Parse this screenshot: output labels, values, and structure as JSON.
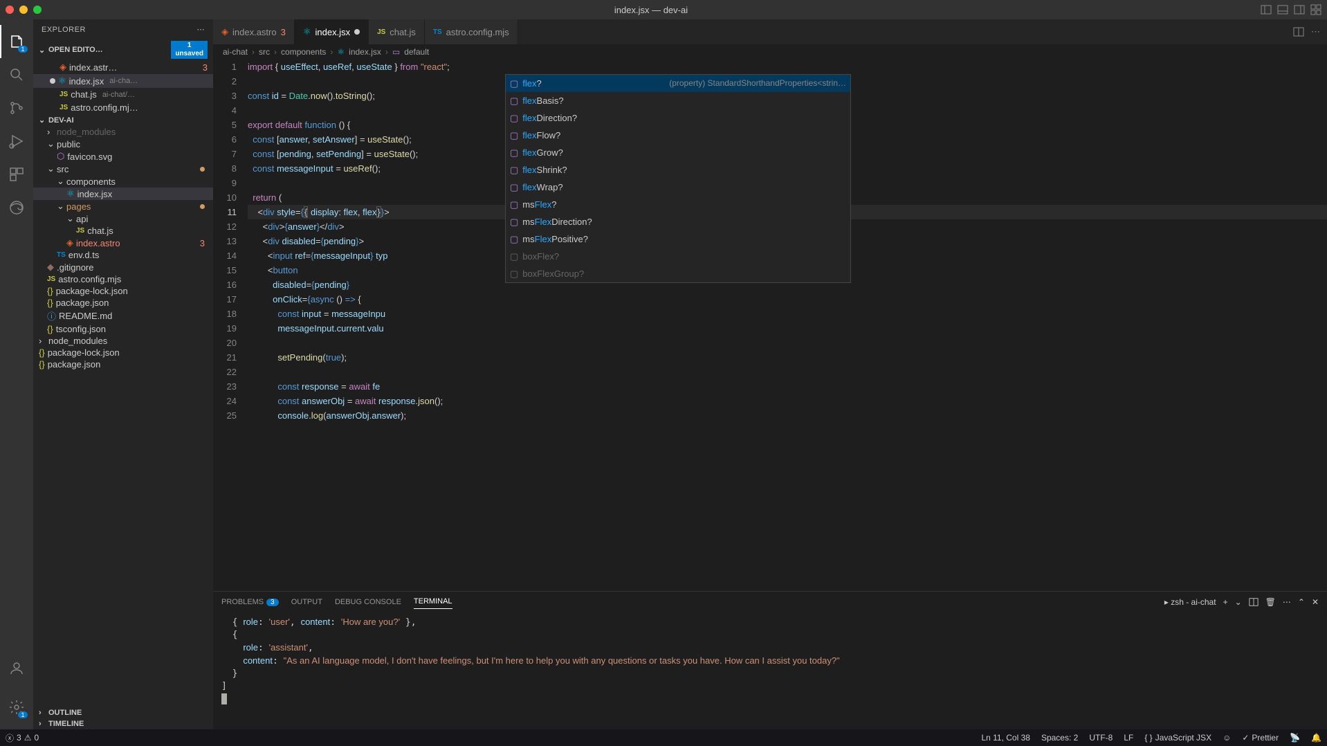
{
  "window": {
    "title": "index.jsx — dev-ai"
  },
  "tabs": [
    {
      "label": "index.astro",
      "err": "3",
      "icon": "astro"
    },
    {
      "label": "index.jsx",
      "dirty": true,
      "icon": "react",
      "active": true
    },
    {
      "label": "chat.js",
      "icon": "js"
    },
    {
      "label": "astro.config.mjs",
      "icon": "ts"
    }
  ],
  "breadcrumb": [
    "ai-chat",
    "src",
    "components",
    "index.jsx",
    "default"
  ],
  "sidebar": {
    "title": "EXPLORER",
    "open_editors_label": "OPEN EDITO…",
    "unsaved": {
      "count": "1",
      "label": "unsaved"
    },
    "open_editors": [
      {
        "name": "index.astr…",
        "err": "3"
      },
      {
        "name": "index.jsx",
        "path": "ai-cha…",
        "dirty": true
      },
      {
        "name": "chat.js",
        "path": "ai-chat/…"
      },
      {
        "name": "astro.config.mj…"
      }
    ],
    "project": "DEV-AI",
    "tree": {
      "node_modules_top": "node_modules",
      "public": "public",
      "favicon": "favicon.svg",
      "src": "src",
      "components": "components",
      "index_jsx": "index.jsx",
      "pages": "pages",
      "api": "api",
      "chat_js": "chat.js",
      "index_astro": "index.astro",
      "index_astro_err": "3",
      "env": "env.d.ts",
      "gitignore": ".gitignore",
      "astro_config": "astro.config.mjs",
      "pkg_lock": "package-lock.json",
      "pkg": "package.json",
      "readme": "README.md",
      "tsconfig": "tsconfig.json",
      "node_modules": "node_modules",
      "pkg_lock2": "package-lock.json",
      "pkg2": "package.json"
    },
    "outline": "OUTLINE",
    "timeline": "TIMELINE"
  },
  "code": {
    "lines": [
      "import { useEffect, useRef, useState } from \"react\";",
      "",
      "const id = Date.now().toString();",
      "",
      "export default function () {",
      "  const [answer, setAnswer] = useState();",
      "  const [pending, setPending] = useState();",
      "  const messageInput = useRef();",
      "",
      "  return (",
      "    <div style={{ display: flex, flex}}>",
      "      <div>{answer}</div>",
      "      <div disabled={pending}>",
      "        <input ref={messageInput} typ",
      "        <button",
      "          disabled={pending}",
      "          onClick={async () => {",
      "            const input = messageInpu",
      "            messageInput.current.valu",
      "",
      "            setPending(true);",
      "",
      "            const response = await fe",
      "            const answerObj = await response.json();",
      "            console.log(answerObj.answer);"
    ]
  },
  "suggest": {
    "doc": "(property) StandardShorthandProperties<strin…",
    "items": [
      {
        "match": "flex",
        "rest": "?",
        "sel": true
      },
      {
        "match": "flex",
        "rest": "Basis?"
      },
      {
        "match": "flex",
        "rest": "Direction?"
      },
      {
        "match": "flex",
        "rest": "Flow?"
      },
      {
        "match": "flex",
        "rest": "Grow?"
      },
      {
        "match": "flex",
        "rest": "Shrink?"
      },
      {
        "match": "flex",
        "rest": "Wrap?"
      },
      {
        "pre": "ms",
        "match": "Flex",
        "rest": "?"
      },
      {
        "pre": "ms",
        "match": "Flex",
        "rest": "Direction?"
      },
      {
        "pre": "ms",
        "match": "Flex",
        "rest": "Positive?"
      },
      {
        "pre": "box",
        "match": "Flex",
        "rest": "?",
        "faded": true
      },
      {
        "pre": "box",
        "match": "Flex",
        "rest": "Group?",
        "faded": true
      }
    ]
  },
  "panel": {
    "tabs": {
      "problems": "PROBLEMS",
      "problems_count": "3",
      "output": "OUTPUT",
      "debug": "DEBUG CONSOLE",
      "terminal": "TERMINAL"
    },
    "shell": "zsh - ai-chat",
    "terminal_text": "  { role: 'user', content: 'How are you?' },\n  {\n    role: 'assistant',\n    content: \"As an AI language model, I don't have feelings, but I'm here to help you with any questions or tasks you have. How can I assist you today?\"\n  }\n]\n"
  },
  "statusbar": {
    "errors": "3",
    "warnings": "0",
    "ln_col": "Ln 11, Col 38",
    "spaces": "Spaces: 2",
    "encoding": "UTF-8",
    "eol": "LF",
    "lang": "JavaScript JSX",
    "prettier": "Prettier"
  }
}
